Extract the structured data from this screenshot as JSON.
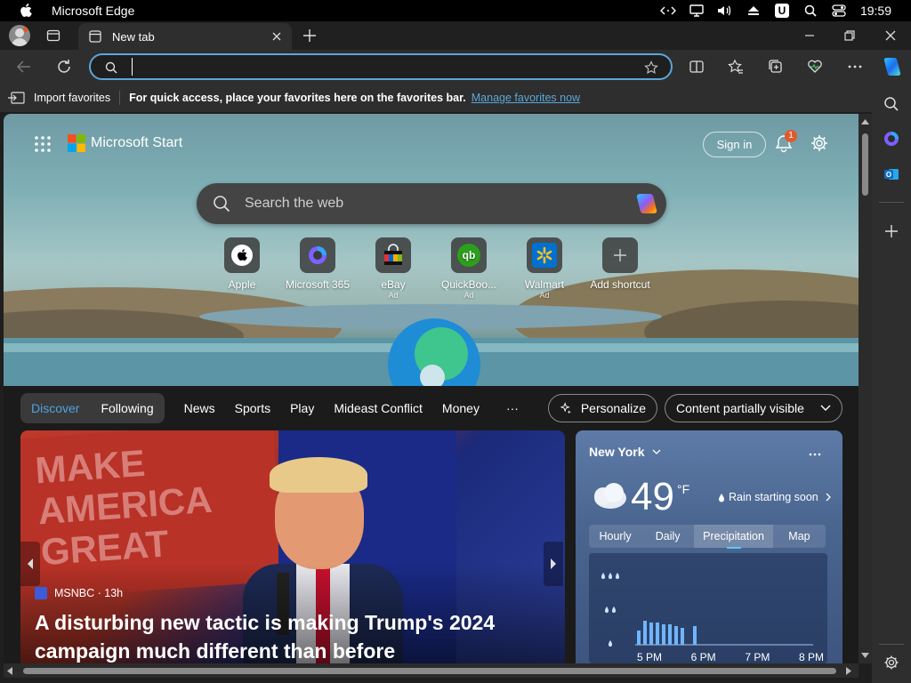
{
  "menubar": {
    "app_name": "Microsoft Edge",
    "clock": "19:59",
    "badge_letter": "U"
  },
  "tab": {
    "title": "New tab"
  },
  "address_bar": {
    "value": "",
    "placeholder": ""
  },
  "favorites_bar": {
    "import_label": "Import favorites",
    "message": "For quick access, place your favorites here on the favorites bar.",
    "manage_link": "Manage favorites now"
  },
  "start": {
    "brand": "Microsoft Start",
    "sign_in": "Sign in",
    "notification_count": "1",
    "search_placeholder": "Search the web",
    "shortcuts": [
      {
        "label": "Apple",
        "ad": ""
      },
      {
        "label": "Microsoft 365",
        "ad": ""
      },
      {
        "label": "eBay",
        "ad": "Ad"
      },
      {
        "label": "QuickBoo...",
        "ad": "Ad"
      },
      {
        "label": "Walmart",
        "ad": "Ad"
      },
      {
        "label": "Add shortcut",
        "ad": ""
      }
    ]
  },
  "feed": {
    "tabs_pill": [
      "Discover",
      "Following"
    ],
    "nav": [
      "News",
      "Sports",
      "Play",
      "Mideast Conflict",
      "Money",
      "···"
    ],
    "personalize": "Personalize",
    "content_visibility": "Content partially visible"
  },
  "news_card": {
    "source": "MSNBC · 13h",
    "headline": "A disturbing new tactic is making Trump's 2024 campaign much different than before",
    "sign_text": "MAKE AMERICA GREAT"
  },
  "weather": {
    "location": "New York",
    "temperature": "49",
    "unit": "°F",
    "alert": "Rain starting soon",
    "tabs": [
      "Hourly",
      "Daily",
      "Precipitation",
      "Map"
    ],
    "active_tab": "Precipitation",
    "time_labels": [
      "5 PM",
      "6 PM",
      "7 PM",
      "8 PM"
    ]
  },
  "colors": {
    "accent_blue": "#5aa7d8",
    "discover_blue": "#4fa3e0",
    "notification_red": "#e05a2b"
  }
}
